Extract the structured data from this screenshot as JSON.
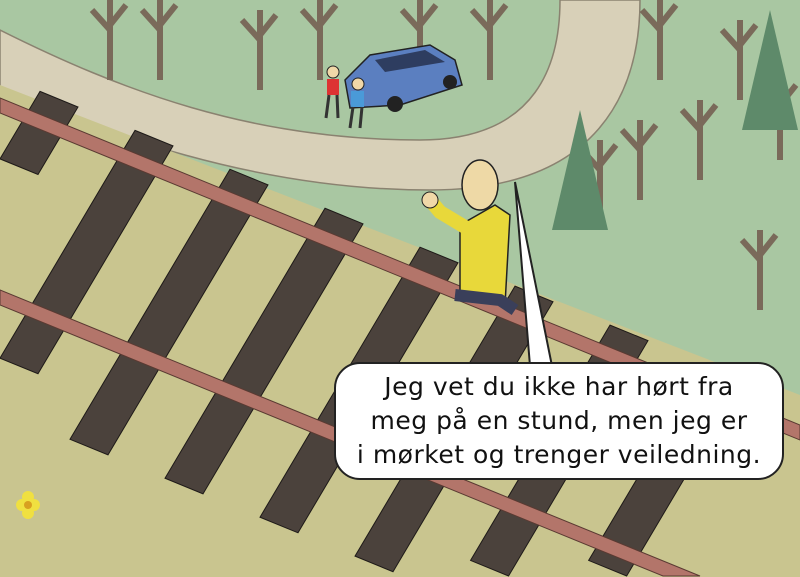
{
  "comic": {
    "speech_bubble": {
      "lines": [
        "Jeg vet du ikke har hørt fra",
        "meg på en stund, men jeg er",
        "i mørket og trenger veiledning."
      ]
    }
  },
  "colors": {
    "grass": "#a9c7a2",
    "road": "#d8d0b8",
    "ballast": "#c9c58f",
    "rail": "#b3756a",
    "sleeper": "#4b423c",
    "shirt": "#e8d83a",
    "car": "#5b7fc0"
  }
}
